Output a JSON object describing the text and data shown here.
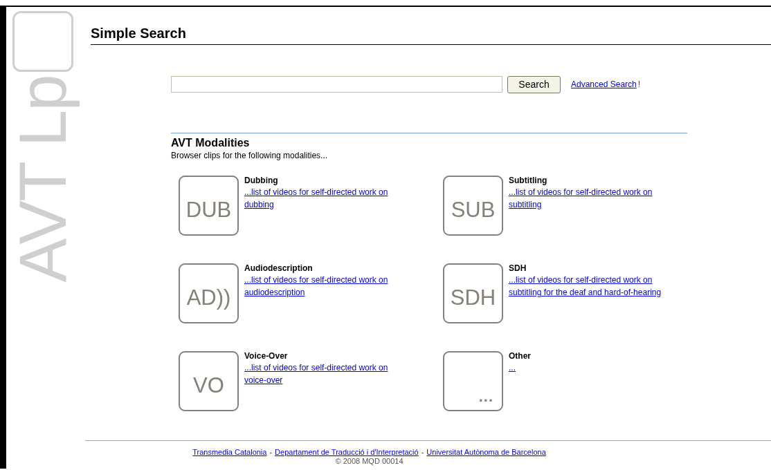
{
  "logo": {
    "text": "AVT Lp"
  },
  "title": "Simple Search",
  "search": {
    "button": "Search",
    "advanced_link": "Advanced Search",
    "advanced_mark": "!"
  },
  "section": {
    "heading": "AVT Modalities",
    "intro": "Browser clips for the following modalities..."
  },
  "modalities": [
    {
      "name": "Dubbing",
      "tile": "DUB",
      "kind": "text",
      "link": "...list of videos for self-directed work on dubbing"
    },
    {
      "name": "Subtitling",
      "tile": "SUB",
      "kind": "text",
      "link": "...list of videos for self-directed work on subtitling"
    },
    {
      "name": "Audiodescription",
      "tile": "AD))",
      "kind": "text",
      "link": "...list of videos for self-directed work on audiodescription"
    },
    {
      "name": "SDH",
      "tile": "SDH",
      "kind": "text",
      "link": "...list of videos for self-directed work on subtitling for the deaf and hard-of-hearing"
    },
    {
      "name": "Voice-Over",
      "tile": "VO",
      "kind": "text",
      "link": "...list of videos for self-directed work on voice-over"
    },
    {
      "name": "Other",
      "tile": "...",
      "kind": "dots",
      "link": "..."
    }
  ],
  "footer": {
    "links": [
      "Transmedia Catalonia",
      "Departament de Traducció i d'Interpretació",
      "Universitat Autònoma de Barcelona"
    ],
    "separator": "-",
    "copyright": "© 2008 MQD 00014"
  }
}
